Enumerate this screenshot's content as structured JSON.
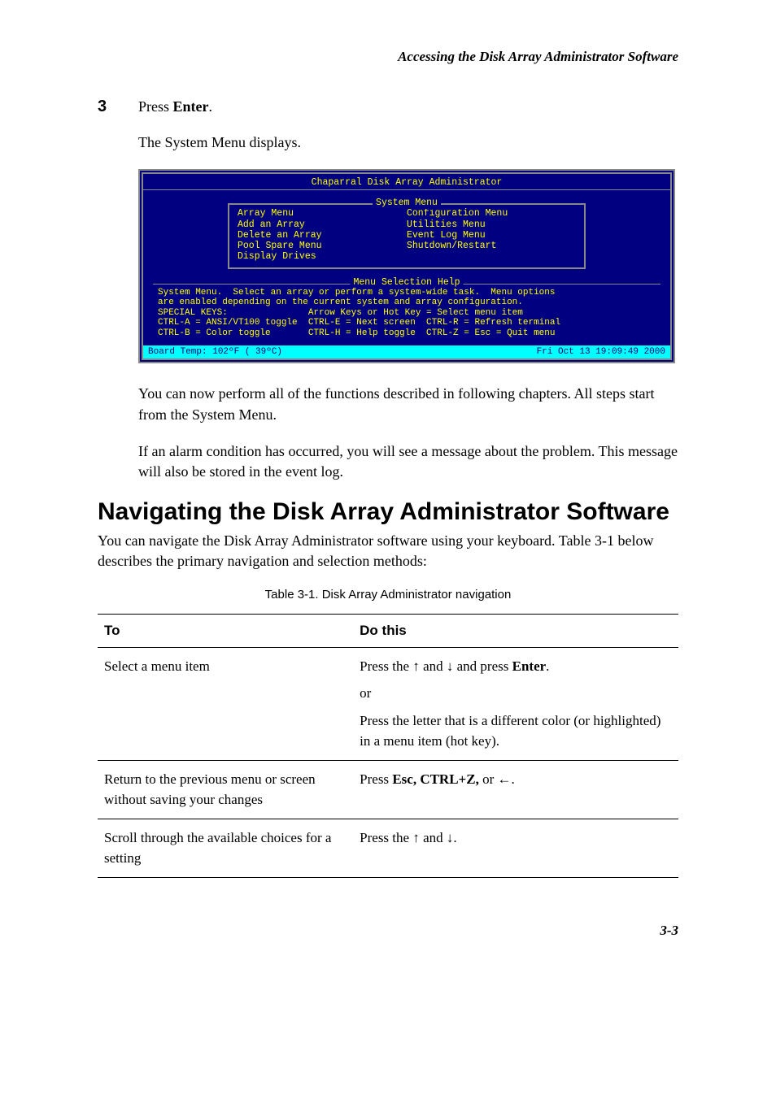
{
  "header": {
    "running_title": "Accessing the Disk Array Administrator Software"
  },
  "step": {
    "number": "3",
    "prefix": "Press ",
    "key": "Enter",
    "suffix": "."
  },
  "paragraphs": {
    "displays": "The System Menu displays.",
    "after_screenshot_1": "You can now perform all of the functions described in following chapters. All steps start from the System Menu.",
    "after_screenshot_2": "If an alarm condition has occurred, you will see a message about the problem. This message will also be stored in the event log."
  },
  "terminal": {
    "title": "Chaparral Disk Array Administrator",
    "menu_label": "System Menu",
    "left_items": [
      "Array Menu",
      "Add an Array",
      "Delete an Array",
      "Pool Spare Menu",
      "Display Drives"
    ],
    "right_items": [
      "Configuration Menu",
      "Utilities Menu",
      "Event Log Menu",
      "Shutdown/Restart"
    ],
    "help_label": "Menu Selection Help",
    "help_text": "System Menu.  Select an array or perform a system-wide task.  Menu options\nare enabled depending on the current system and array configuration.\nSPECIAL KEYS:               Arrow Keys or Hot Key = Select menu item\nCTRL-A = ANSI/VT100 toggle  CTRL-E = Next screen  CTRL-R = Refresh terminal\nCTRL-B = Color toggle       CTRL-H = Help toggle  CTRL-Z = Esc = Quit menu",
    "status_left": "Board Temp: 102ºF ( 39ºC)",
    "status_right": "Fri Oct 13 19:09:49 2000"
  },
  "section": {
    "heading": "Navigating the Disk Array Administrator Software",
    "intro": "You can navigate the Disk Array Administrator software using your keyboard. Table 3-1 below describes the primary navigation and selection methods:"
  },
  "table": {
    "caption": "Table 3-1. Disk Array Administrator navigation",
    "head_to": "To",
    "head_do": "Do this",
    "rows": [
      {
        "to": "Select a menu item",
        "do_prefix": "Press the ↑ and ↓ and press ",
        "do_bold": "Enter",
        "do_suffix": ".",
        "do_line2": "or",
        "do_line3": "Press the letter that is a different color (or highlighted) in a menu item (hot key)."
      },
      {
        "to": "Return to the previous menu or screen without saving your changes",
        "do_prefix": "Press ",
        "do_bold": "Esc, CTRL+Z,",
        "do_suffix": " or ←."
      },
      {
        "to": "Scroll through the available choices for a setting",
        "do_plain": "Press the ↑ and ↓."
      }
    ]
  },
  "footer": {
    "page_number": "3-3"
  }
}
